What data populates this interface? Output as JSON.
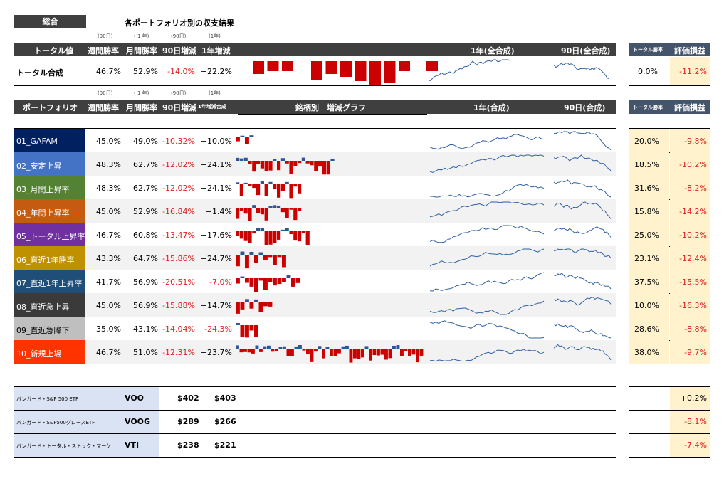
{
  "header": {
    "tag": "総合",
    "title": "各ポートフォリオ別の収支結果"
  },
  "sub_labels": [
    "(90日)",
    "( 1 年)",
    "(90日)",
    "(1年)"
  ],
  "total_header": {
    "name": "トータル値",
    "cols": [
      "週間勝率",
      "月間勝率",
      "90日増減",
      "1年増減"
    ],
    "g1": "1年(全合成)",
    "g2": "90日(全合成)",
    "s1": "トータル勝率",
    "s2": "評価損益"
  },
  "total_row": {
    "name": "トータル合成",
    "weekly": "46.7%",
    "monthly": "52.9%",
    "d90": "-14.0%",
    "y1": "+22.2%",
    "win": "0.0%",
    "pl": "-11.2%"
  },
  "portfolio_header": {
    "name": "ポートフォリオ",
    "cols": [
      "週間勝率",
      "月間勝率",
      "90日増減",
      "1年増減合成"
    ],
    "bars": "銘柄別　増減グラフ",
    "g1": "1年(合成)",
    "g2": "90日(合成)",
    "s1": "トータル勝率",
    "s2": "評価損益"
  },
  "portfolios": [
    {
      "name": "01_GAFAM",
      "color": "#002060",
      "weekly": "45.0%",
      "monthly": "49.0%",
      "d90": "-10.32%",
      "y1": "+10.0%",
      "y1neg": false,
      "win": "20.0%",
      "pl": "-9.8%"
    },
    {
      "name": "02_安定上昇",
      "color": "#4472c4",
      "weekly": "48.3%",
      "monthly": "62.7%",
      "d90": "-12.02%",
      "y1": "+24.1%",
      "y1neg": false,
      "win": "18.5%",
      "pl": "-10.2%"
    },
    {
      "name": "03_月間上昇率",
      "color": "#548235",
      "weekly": "48.3%",
      "monthly": "62.7%",
      "d90": "-12.02%",
      "y1": "+24.1%",
      "y1neg": false,
      "win": "31.6%",
      "pl": "-8.2%"
    },
    {
      "name": "04_年間上昇率",
      "color": "#c55a11",
      "weekly": "45.0%",
      "monthly": "52.9%",
      "d90": "-16.84%",
      "y1": "+1.4%",
      "y1neg": false,
      "win": "15.8%",
      "pl": "-14.2%"
    },
    {
      "name": "05_トータル上昇率",
      "color": "#7030a0",
      "weekly": "46.7%",
      "monthly": "60.8%",
      "d90": "-13.47%",
      "y1": "+17.6%",
      "y1neg": false,
      "win": "25.0%",
      "pl": "-10.2%"
    },
    {
      "name": "06_直近1年勝率",
      "color": "#bf9000",
      "weekly": "43.3%",
      "monthly": "64.7%",
      "d90": "-15.86%",
      "y1": "+24.7%",
      "y1neg": false,
      "win": "23.1%",
      "pl": "-12.4%"
    },
    {
      "name": "07_直近1年上昇率",
      "color": "#1f4e79",
      "weekly": "41.7%",
      "monthly": "56.9%",
      "d90": "-20.51%",
      "y1": "-7.0%",
      "y1neg": true,
      "win": "37.5%",
      "pl": "-15.5%"
    },
    {
      "name": "08_直近急上昇",
      "color": "#3a3a3a",
      "weekly": "45.0%",
      "monthly": "56.9%",
      "d90": "-15.88%",
      "y1": "+14.7%",
      "y1neg": false,
      "win": "10.0%",
      "pl": "-16.3%"
    },
    {
      "name": "09_直近急降下",
      "color": "#bfbfbf",
      "weekly": "35.0%",
      "monthly": "43.1%",
      "d90": "-14.04%",
      "y1": "-24.3%",
      "y1neg": true,
      "win": "28.6%",
      "pl": "-8.8%",
      "dark": true
    },
    {
      "name": "10_新規上場",
      "color": "#ff3300",
      "weekly": "46.7%",
      "monthly": "51.0%",
      "d90": "-12.31%",
      "y1": "+23.7%",
      "y1neg": false,
      "win": "38.0%",
      "pl": "-9.7%"
    }
  ],
  "etfs": [
    {
      "name": "バンガード・S&P 500 ETF",
      "ticker": "VOO",
      "p1": "$402",
      "p2": "$403",
      "pl": "+0.2%"
    },
    {
      "name": "バンガード・S&P500グロースETF",
      "ticker": "VOOG",
      "p1": "$289",
      "p2": "$266",
      "pl": "-8.1%"
    },
    {
      "name": "バンガード・トータル・ストック・マーケ",
      "ticker": "VTI",
      "p1": "$238",
      "p2": "$221",
      "pl": "-7.4%"
    }
  ],
  "colors": {
    "header": "#3f3f3f",
    "side_header": "#44546a",
    "down": "#cc0000",
    "up": "#2f5597",
    "line": "#2e5fa3",
    "pl_bg": "#fff2cc",
    "etf_bg": "#dae3f3"
  }
}
